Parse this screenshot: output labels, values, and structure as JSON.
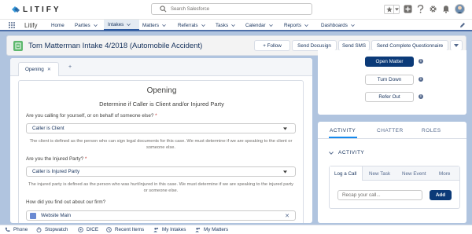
{
  "brand": {
    "name": "LITIFY",
    "accent": "#0b3a78",
    "logo_icon": "litify-logo-icon"
  },
  "search": {
    "placeholder": "Search Salesforce"
  },
  "header_utils": [
    "favorites-star-icon",
    "chevron-down-icon",
    "add-icon",
    "help-icon",
    "setup-gear-icon",
    "notifications-bell-icon",
    "avatar"
  ],
  "nav": {
    "app_name": "Litify",
    "items": [
      {
        "label": "Home",
        "has_menu": false
      },
      {
        "label": "Parties",
        "has_menu": true
      },
      {
        "label": "Intakes",
        "has_menu": true,
        "active": true
      },
      {
        "label": "Matters",
        "has_menu": true
      },
      {
        "label": "Referrals",
        "has_menu": true
      },
      {
        "label": "Tasks",
        "has_menu": true
      },
      {
        "label": "Calendar",
        "has_menu": true
      },
      {
        "label": "Reports",
        "has_menu": true
      },
      {
        "label": "Dashboards",
        "has_menu": true
      }
    ]
  },
  "page_header": {
    "title": "Tom Matterman Intake 4/2018 (Automobile Accident)",
    "actions": [
      "+ Follow",
      "Send Docusign",
      "Send SMS",
      "Send Complete Questionnaire"
    ]
  },
  "workspace_tabs": {
    "active": "Opening",
    "add": "+"
  },
  "form": {
    "title": "Opening",
    "subtitle": "Determine if Caller is Client and/or Injured Party",
    "q1": {
      "label": "Are you calling for yourself, or on behalf of someone else?",
      "required": "*",
      "value": "Caller is Client",
      "help": "The client is defined as the person who can sign legal documents for this case. We must determine if we are speaking to the client or someone else."
    },
    "q2": {
      "label": "Are you the Injured Party?",
      "required": "*",
      "value": "Caller is Injured Party",
      "help": "The injured party is defined as the person who was hurt/injured in this case. We must determine if we are speaking to the injured party or someone else."
    },
    "q3": {
      "label": "How did you find out about our firm?",
      "value": "Website Main"
    }
  },
  "record_actions": [
    "Open Matter",
    "Turn Down",
    "Refer Out"
  ],
  "activity_panel": {
    "tabs": [
      "ACTIVITY",
      "CHATTER",
      "ROLES"
    ],
    "active_tab": "ACTIVITY",
    "section_title": "ACTIVITY",
    "composer_tabs": [
      "Log a Call",
      "New Task",
      "New Event",
      "More"
    ],
    "recap_placeholder": "Recap your call...",
    "add_label": "Add"
  },
  "utility_bar": [
    {
      "label": "Phone",
      "icon": "phone-icon"
    },
    {
      "label": "Stopwatch",
      "icon": "stopwatch-icon"
    },
    {
      "label": "DICE",
      "icon": "dice-icon"
    },
    {
      "label": "Recent Items",
      "icon": "clock-icon"
    },
    {
      "label": "My Intakes",
      "icon": "people-icon"
    },
    {
      "label": "My Matters",
      "icon": "people-icon"
    }
  ]
}
